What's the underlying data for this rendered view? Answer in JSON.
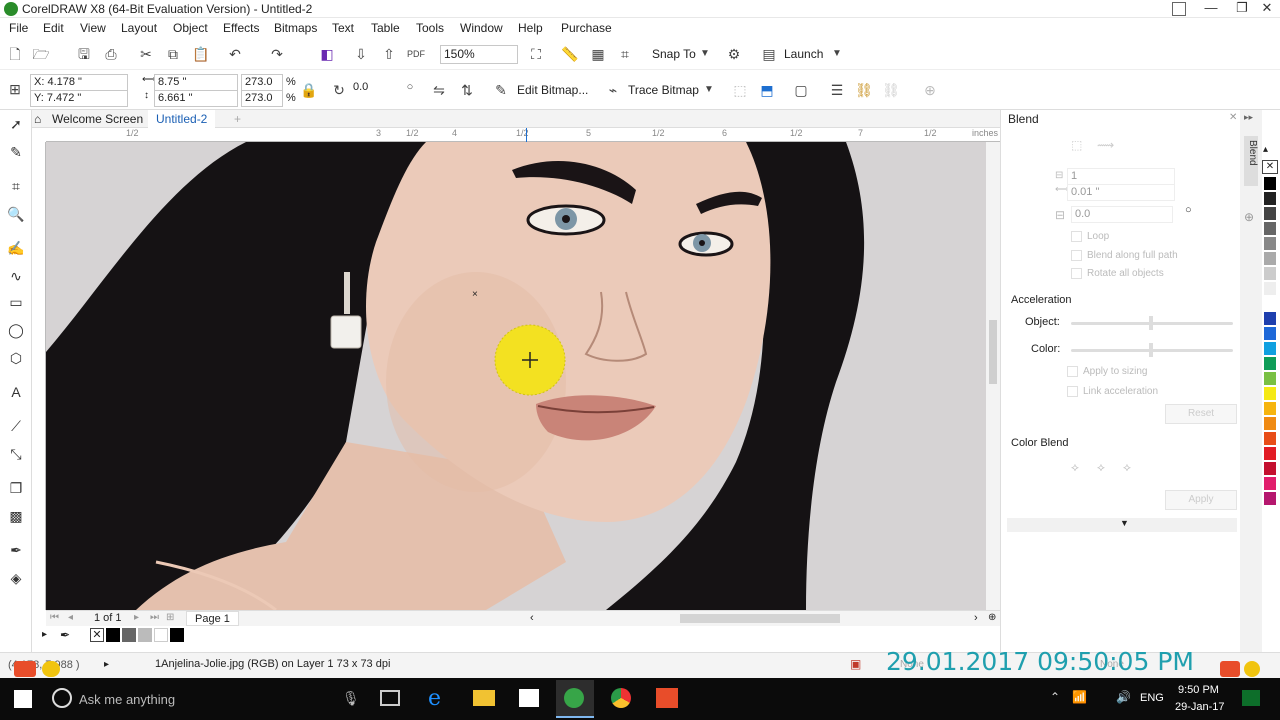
{
  "window": {
    "title": "CorelDRAW X8 (64-Bit Evaluation Version) - Untitled-2",
    "min": "—",
    "max": "❐",
    "close": "✕"
  },
  "menu": [
    "File",
    "Edit",
    "View",
    "Layout",
    "Object",
    "Effects",
    "Bitmaps",
    "Text",
    "Table",
    "Tools",
    "Window",
    "Help",
    "Purchase"
  ],
  "stdbar": {
    "zoom": "150%",
    "snap_to": "Snap To",
    "launch": "Launch"
  },
  "propbar": {
    "x": "X: 4.178 \"",
    "y": "Y: 7.472 \"",
    "w": "8.75 \"",
    "h": "6.661 \"",
    "sx": "273.0",
    "sy": "273.0",
    "pct": "%",
    "rotation": "0.0",
    "edit_bitmap": "Edit Bitmap...",
    "trace_bitmap": "Trace Bitmap"
  },
  "tabs": {
    "welcome": "Welcome Screen",
    "doc": "Untitled-2",
    "add": "+"
  },
  "ruler": {
    "labels": [
      "1/2",
      "3",
      "1/2",
      "4",
      "1/2",
      "5",
      "1/2",
      "6",
      "1/2",
      "7",
      "1/2",
      "inches"
    ]
  },
  "pagenav": {
    "count": "1 of 1",
    "page": "Page 1"
  },
  "docker": {
    "title": "Blend",
    "side_tab": "Blend",
    "steps": "1",
    "spacing": "0.01 \"",
    "angle": "0.0",
    "opt_loop": "Loop",
    "opt_blend_path": "Blend along full path",
    "opt_rotate": "Rotate all objects",
    "acceleration": "Acceleration",
    "object": "Object:",
    "color": "Color:",
    "apply_sizing": "Apply to sizing",
    "link_accel": "Link acceleration",
    "reset": "Reset",
    "color_blend": "Color Blend",
    "apply": "Apply"
  },
  "status": {
    "coords": "(4.178, 7.988 )",
    "info": "1Anjelina-Jolie.jpg (RGB) on Layer 1 73 x 73 dpi",
    "fill_none": "None",
    "outline_none": "None",
    "stamp": "29.01.2017 09:50:05 PM"
  },
  "taskbar": {
    "search": "Ask me anything",
    "lang": "ENG",
    "time": "9:50 PM",
    "date": "29-Jan-17"
  },
  "palette": [
    "#000000",
    "#222222",
    "#444444",
    "#666666",
    "#888888",
    "#aaaaaa",
    "#cccccc",
    "#eeeeee",
    "#ffffff",
    "#1e3fae",
    "#1e68d8",
    "#10a0e0",
    "#0f9d58",
    "#7ac043",
    "#f5e914",
    "#f6b40e",
    "#f08a12",
    "#e84d18",
    "#e21c25",
    "#c4102f",
    "#e11e6c",
    "#b5176e"
  ],
  "colors": {
    "canvas_bg": "#d6d3d4",
    "hair": "#141113",
    "skin": "#e9c7b6",
    "blend_circle": "#f3e121",
    "stamp": "#1f9fae"
  }
}
